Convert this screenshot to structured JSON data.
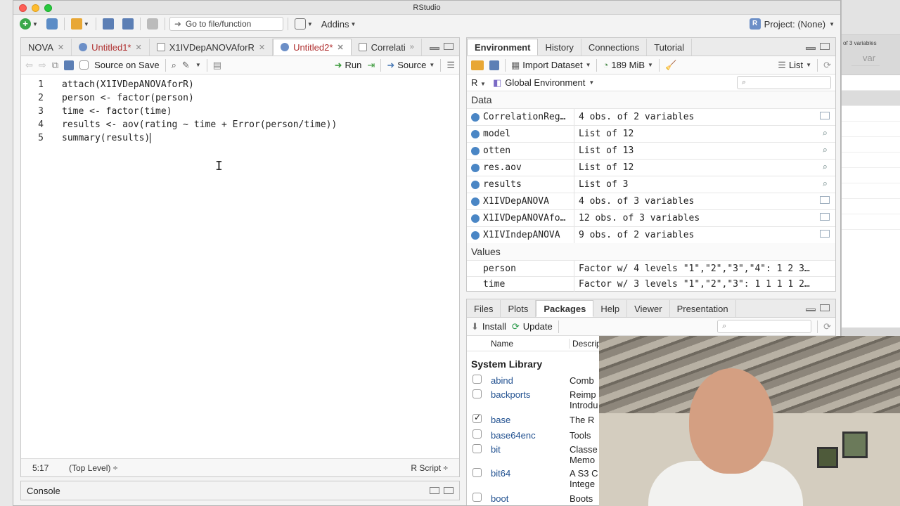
{
  "app": {
    "title": "RStudio"
  },
  "toolbar": {
    "goto_placeholder": "Go to file/function",
    "addins_label": "Addins",
    "project_label": "Project: (None)"
  },
  "source": {
    "tabs": [
      {
        "label": "NOVA",
        "color": "normal"
      },
      {
        "label": "Untitled1*",
        "color": "red"
      },
      {
        "label": "X1IVDepANOVAforR",
        "color": "normal"
      },
      {
        "label": "Untitled2*",
        "color": "red"
      },
      {
        "label": "Correlati",
        "color": "normal"
      }
    ],
    "source_on_save": "Source on Save",
    "run_label": "Run",
    "source_label": "Source",
    "lines": [
      {
        "n": "1",
        "code": "attach(X1IVDepANOVAforR)"
      },
      {
        "n": "2",
        "code": "person <- factor(person)"
      },
      {
        "n": "3",
        "code": "time <- factor(time)"
      },
      {
        "n": "4",
        "code": "results <- aov(rating ~ time + Error(person/time))"
      },
      {
        "n": "5",
        "code": "summary(results)"
      }
    ],
    "status_position": "5:17",
    "status_scope": "(Top Level) ÷",
    "status_type": "R Script ÷"
  },
  "console": {
    "label": "Console"
  },
  "environment": {
    "tabs": [
      "Environment",
      "History",
      "Connections",
      "Tutorial"
    ],
    "import_label": "Import Dataset",
    "memory": "189 MiB",
    "list_label": "List",
    "lang": "R",
    "global_env": "Global Environment",
    "data_header": "Data",
    "values_header": "Values",
    "data_rows": [
      {
        "name": "CorrelationReg…",
        "value": "4 obs. of 2 variables",
        "icon": "table-icon"
      },
      {
        "name": "model",
        "value": "List of  12",
        "icon": "magnifier-icon"
      },
      {
        "name": "otten",
        "value": "List of  13",
        "icon": "magnifier-icon"
      },
      {
        "name": "res.aov",
        "value": "List of  12",
        "icon": "magnifier-icon"
      },
      {
        "name": "results",
        "value": "List of  3",
        "icon": "magnifier-icon"
      },
      {
        "name": "X1IVDepANOVA",
        "value": "4 obs. of 3 variables",
        "icon": "table-icon"
      },
      {
        "name": "X1IVDepANOVAfo…",
        "value": "12 obs. of 3 variables",
        "icon": "table-icon"
      },
      {
        "name": "X1IVIndepANOVA",
        "value": "9 obs. of 2 variables",
        "icon": "table-icon"
      }
    ],
    "value_rows": [
      {
        "name": "person",
        "value": "Factor w/ 4 levels \"1\",\"2\",\"3\",\"4\": 1 2 3…"
      },
      {
        "name": "time",
        "value": "Factor w/ 3 levels \"1\",\"2\",\"3\": 1 1 1 1 2…"
      }
    ]
  },
  "files": {
    "tabs": [
      "Files",
      "Plots",
      "Packages",
      "Help",
      "Viewer",
      "Presentation"
    ],
    "install_label": "Install",
    "update_label": "Update",
    "col_name": "Name",
    "col_desc": "Descrip",
    "system_library": "System Library",
    "packages": [
      {
        "name": "abind",
        "desc": "Comb",
        "checked": false
      },
      {
        "name": "backports",
        "desc": "Reimp",
        "desc2": "Introdu",
        "checked": false
      },
      {
        "name": "base",
        "desc": "The R",
        "checked": true
      },
      {
        "name": "base64enc",
        "desc": "Tools",
        "checked": false
      },
      {
        "name": "bit",
        "desc": "Classe",
        "desc2": "Memo",
        "checked": false
      },
      {
        "name": "bit64",
        "desc": "A S3 C",
        "desc2": "Intege",
        "checked": false
      },
      {
        "name": "boot",
        "desc": "Boots",
        "checked": false
      }
    ]
  },
  "background_window": {
    "label": "of 3 variables",
    "var_label": "var"
  }
}
